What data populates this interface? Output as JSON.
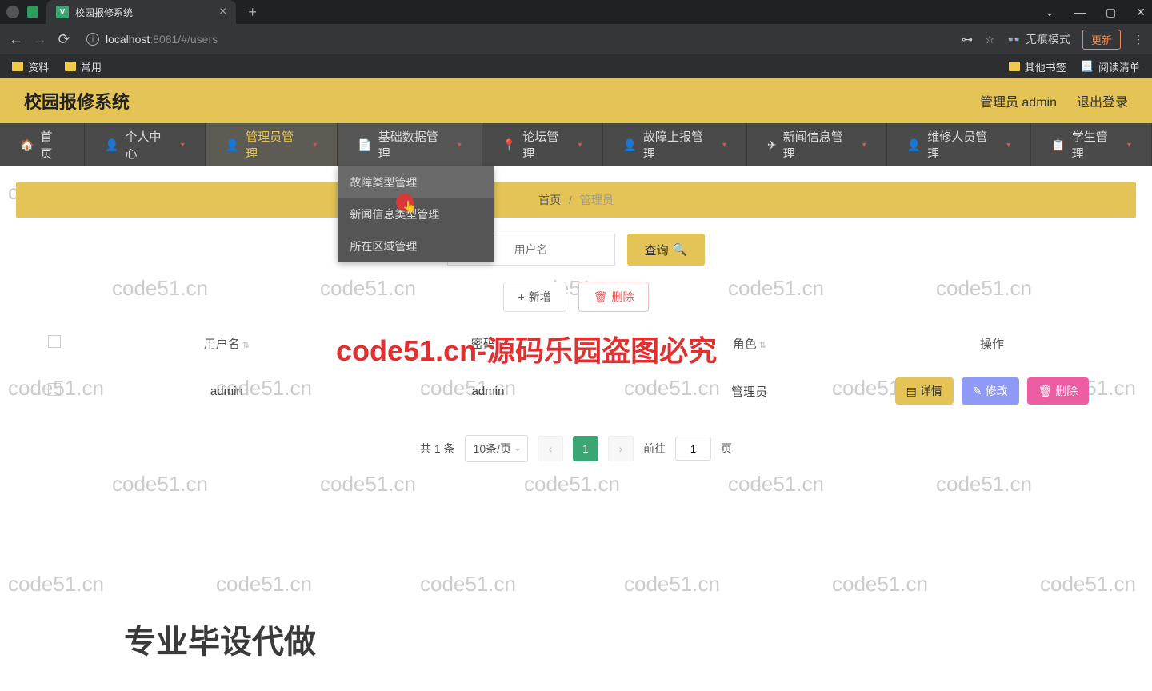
{
  "browser": {
    "tab_title": "校园报修系统",
    "url_host": "localhost",
    "url_path": ":8081/#/users",
    "update_btn": "更新",
    "incognito_label": "无痕模式",
    "bookmarks": [
      "资料",
      "常用"
    ],
    "bookmarks_right": [
      "其他书签",
      "阅读清单"
    ]
  },
  "header": {
    "title": "校园报修系统",
    "user_label": "管理员 admin",
    "logout": "退出登录"
  },
  "nav": {
    "items": [
      {
        "label": "首页",
        "icon": "🏠",
        "caret": false
      },
      {
        "label": "个人中心",
        "icon": "👤",
        "caret": true
      },
      {
        "label": "管理员管理",
        "icon": "👤",
        "caret": true
      },
      {
        "label": "基础数据管理",
        "icon": "📄",
        "caret": true
      },
      {
        "label": "论坛管理",
        "icon": "📍",
        "caret": true
      },
      {
        "label": "故障上报管理",
        "icon": "👤",
        "caret": true
      },
      {
        "label": "新闻信息管理",
        "icon": "✈",
        "caret": true
      },
      {
        "label": "维修人员管理",
        "icon": "👤",
        "caret": true
      },
      {
        "label": "学生管理",
        "icon": "📋",
        "caret": true
      }
    ],
    "dropdown": [
      "故障类型管理",
      "新闻信息类型管理",
      "所在区域管理"
    ]
  },
  "breadcrumb": {
    "home": "首页",
    "current": "管理员"
  },
  "search": {
    "placeholder": "用户名",
    "btn": "查询"
  },
  "actions": {
    "add": "新增",
    "delete": "删除"
  },
  "table": {
    "columns": [
      "用户名",
      "密码",
      "角色",
      "操作"
    ],
    "rows": [
      {
        "user": "admin",
        "pass": "admin",
        "role": "管理员"
      }
    ],
    "ops": {
      "detail": "详情",
      "edit": "修改",
      "delete": "删除"
    }
  },
  "pagination": {
    "total": "共 1 条",
    "per_page": "10条/页",
    "current": "1",
    "goto": "前往",
    "goto_value": "1",
    "page_suffix": "页"
  },
  "overlay": {
    "red_text": "code51.cn-源码乐园盗图必究",
    "bottom_text": "专业毕设代做",
    "watermark": "code51.cn"
  }
}
